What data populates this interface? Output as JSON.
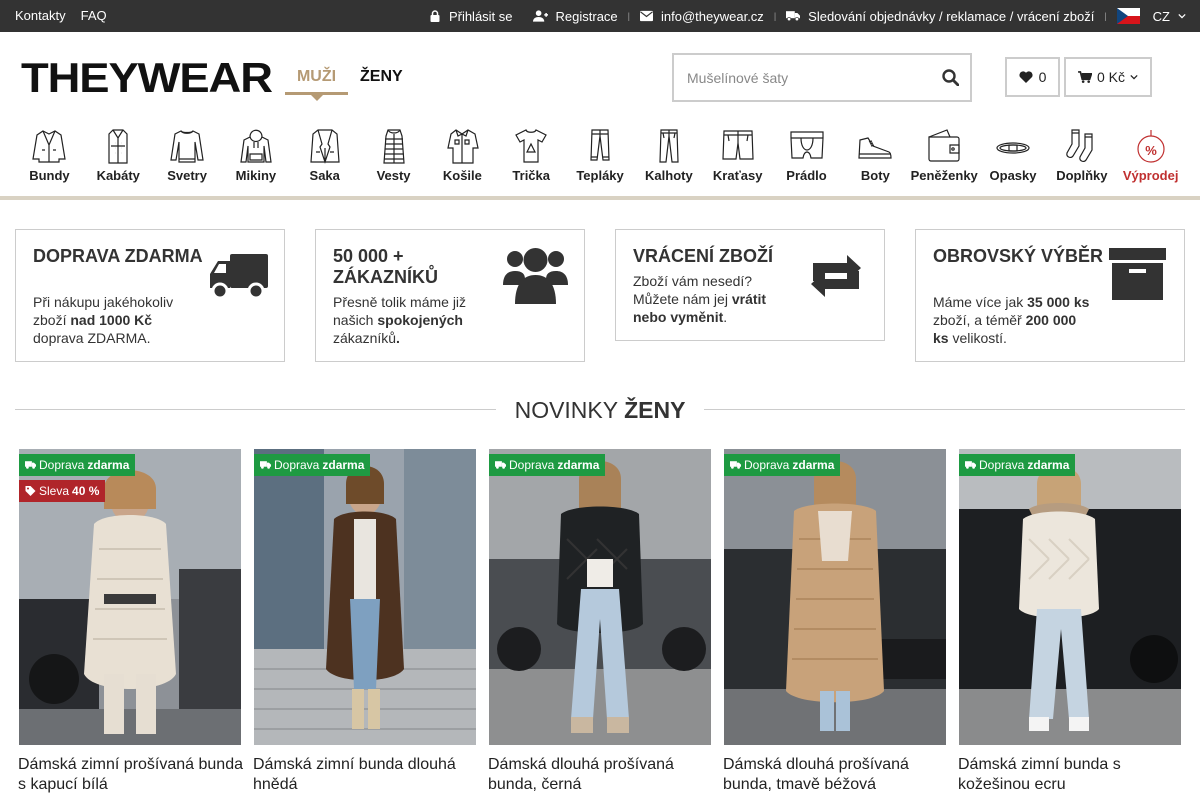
{
  "topbar": {
    "links": [
      "Kontakty",
      "FAQ"
    ],
    "login": "Přihlásit se",
    "register": "Registrace",
    "email": "info@theywear.cz",
    "tracking": "Sledování objednávky / reklamace / vrácení zboží",
    "language": "CZ"
  },
  "header": {
    "logo": "THEYWEAR",
    "gender_men": "MUŽI",
    "gender_women": "ŽENY",
    "search_placeholder": "Mušelínové šaty",
    "wishlist_count": "0",
    "cart_total": "0 Kč"
  },
  "categories": [
    {
      "label": "Bundy",
      "icon": "jacket-icon"
    },
    {
      "label": "Kabáty",
      "icon": "coat-icon"
    },
    {
      "label": "Svetry",
      "icon": "sweater-icon"
    },
    {
      "label": "Mikiny",
      "icon": "hoodie-icon"
    },
    {
      "label": "Saka",
      "icon": "blazer-icon"
    },
    {
      "label": "Vesty",
      "icon": "vest-icon"
    },
    {
      "label": "Košile",
      "icon": "shirt-icon"
    },
    {
      "label": "Trička",
      "icon": "tshirt-icon"
    },
    {
      "label": "Tepláky",
      "icon": "sweatpants-icon"
    },
    {
      "label": "Kalhoty",
      "icon": "trousers-icon"
    },
    {
      "label": "Kraťasy",
      "icon": "shorts-icon"
    },
    {
      "label": "Prádlo",
      "icon": "underwear-icon"
    },
    {
      "label": "Boty",
      "icon": "shoe-icon"
    },
    {
      "label": "Peněženky",
      "icon": "wallet-icon"
    },
    {
      "label": "Opasky",
      "icon": "belt-icon"
    },
    {
      "label": "Doplňky",
      "icon": "socks-icon"
    },
    {
      "label": "Výprodej",
      "icon": "sale-tag-icon"
    }
  ],
  "benefits": [
    {
      "title": "DOPRAVA ZDARMA",
      "t1": "Při nákupu jakéhokoliv zboží ",
      "b1": "nad 1000 Kč",
      "t2": " doprava ZDARMA.",
      "icon": "truck-icon"
    },
    {
      "title": "50 000 + ZÁKAZNÍKŮ",
      "t1": "Přesně tolik máme již našich ",
      "b1": "spokojených",
      "t2": " zákazníků",
      "b2": ".",
      "icon": "users-icon"
    },
    {
      "title": "VRÁCENÍ ZBOŽÍ",
      "t1": "Zboží vám nesedí? Můžete nám jej ",
      "b1": "vrátit nebo vyměnit",
      "t2": ".",
      "icon": "exchange-icon"
    },
    {
      "title": "OBROVSKÝ VÝBĚR",
      "t1": "Máme více jak ",
      "b1": "35 000 ks",
      "t2": " zboží, a téměř ",
      "b2": "200 000 ks",
      "t3": " velikostí.",
      "icon": "archive-box-icon"
    }
  ],
  "section": {
    "title_light": "NOVINKY ",
    "title_bold": "ŽENY"
  },
  "products": [
    {
      "name": "Dámská zimní prošívaná bunda s kapucí bílá",
      "shipping_a": "Doprava ",
      "shipping_b": "zdarma",
      "discount_a": "Sleva ",
      "discount_b": "40 %"
    },
    {
      "name": "Dámská zimní bunda dlouhá hnědá",
      "shipping_a": "Doprava ",
      "shipping_b": "zdarma"
    },
    {
      "name": "Dámská dlouhá prošívaná bunda, černá",
      "shipping_a": "Doprava ",
      "shipping_b": "zdarma"
    },
    {
      "name": "Dámská dlouhá prošívaná bunda, tmavě béžová",
      "shipping_a": "Doprava ",
      "shipping_b": "zdarma"
    },
    {
      "name": "Dámská zimní bunda s kožešinou ecru",
      "shipping_a": "Doprava ",
      "shipping_b": "zdarma"
    }
  ],
  "colors": {
    "accent": "#b59a74",
    "topbar": "#333333",
    "sale_red": "#c03030",
    "shipping_green": "#1e9a42",
    "discount_red": "#b0252a"
  }
}
